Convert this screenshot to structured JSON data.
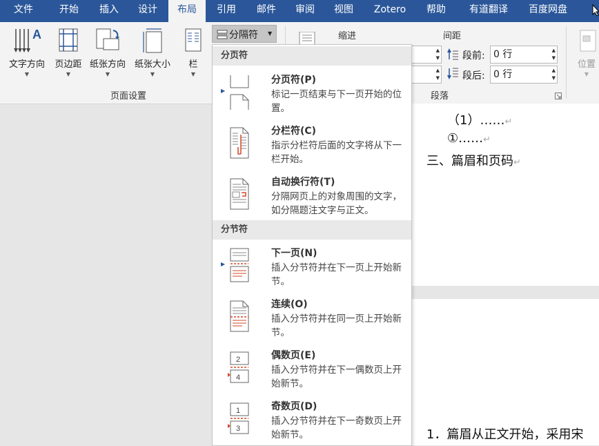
{
  "tabs": [
    {
      "label": "文件",
      "active": false
    },
    {
      "label": "开始",
      "active": false
    },
    {
      "label": "插入",
      "active": false
    },
    {
      "label": "设计",
      "active": false
    },
    {
      "label": "布局",
      "active": true
    },
    {
      "label": "引用",
      "active": false
    },
    {
      "label": "邮件",
      "active": false
    },
    {
      "label": "审阅",
      "active": false
    },
    {
      "label": "视图",
      "active": false
    },
    {
      "label": "Zotero",
      "active": false
    },
    {
      "label": "帮助",
      "active": false
    },
    {
      "label": "有道翻译",
      "active": false
    },
    {
      "label": "百度网盘",
      "active": false
    }
  ],
  "ribbon": {
    "page_setup": {
      "text_direction": "文字方向",
      "margins": "页边距",
      "orientation": "纸张方向",
      "size": "纸张大小",
      "columns": "栏",
      "breaks": "分隔符",
      "group_label": "页面设置"
    },
    "paragraph": {
      "indent_label": "缩进",
      "spacing_label": "间距",
      "before_label": "段前:",
      "before_value": "0 行",
      "after_label": "段后:",
      "after_value": "0 行",
      "group_label": "段落"
    },
    "arrange": {
      "position": "位置"
    }
  },
  "breaks_menu": {
    "page_breaks_header": "分页符",
    "section_breaks_header": "分节符",
    "page_items": [
      {
        "title": "分页符(P)",
        "desc": "标记一页结束与下一页开始的位置。",
        "icon": "page-break-icon"
      },
      {
        "title": "分栏符(C)",
        "desc": "指示分栏符后面的文字将从下一栏开始。",
        "icon": "column-break-icon"
      },
      {
        "title": "自动换行符(T)",
        "desc": "分隔网页上的对象周围的文字，如分隔题注文字与正文。",
        "icon": "text-wrapping-break-icon"
      }
    ],
    "section_items": [
      {
        "title": "下一页(N)",
        "desc": "插入分节符并在下一页上开始新节。",
        "icon": "next-page-break-icon"
      },
      {
        "title": "连续(O)",
        "desc": "插入分节符并在同一页上开始新节。",
        "icon": "continuous-break-icon"
      },
      {
        "title": "偶数页(E)",
        "desc": "插入分节符并在下一偶数页上开始新节。",
        "icon": "even-page-break-icon"
      },
      {
        "title": "奇数页(D)",
        "desc": "插入分节符并在下一奇数页上开始新节。",
        "icon": "odd-page-break-icon"
      }
    ]
  },
  "document": {
    "line1": "（1）……",
    "line2": "①……",
    "line3": "三、篇眉和页码",
    "line4": "1．篇眉从正文开始，采用宋"
  },
  "colors": {
    "accent": "#2b579a",
    "orange": "#d24726"
  }
}
